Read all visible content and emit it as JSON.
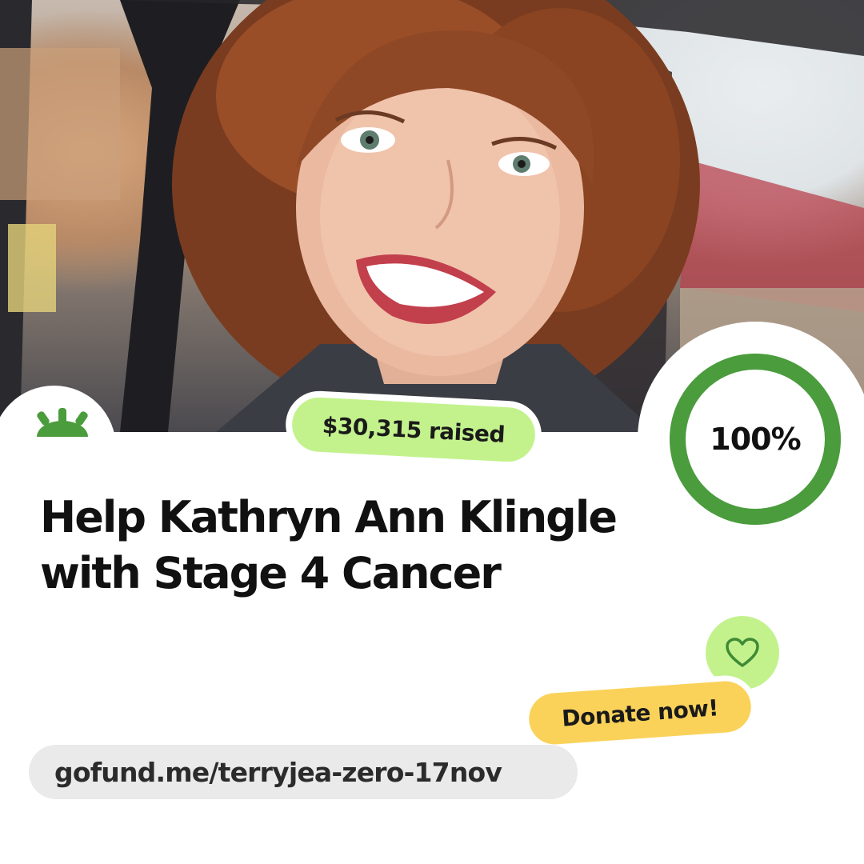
{
  "brand": {
    "logo_icon": "gofundme-sunrise-logo-icon",
    "accent_color": "#4a9c3c",
    "light_green": "#c3f28d",
    "yellow": "#fad25a"
  },
  "photo": {
    "icon": "campaign-photo"
  },
  "campaign": {
    "raised_label": "$30,315 raised",
    "progress_label": "100%",
    "progress_fraction": 1.0,
    "title_line1": "Help Kathryn Ann Klingle",
    "title_line2": "with Stage 4 Cancer"
  },
  "cta": {
    "heart_icon": "heart-icon",
    "donate_label": "Donate now!"
  },
  "link": {
    "url": "gofund.me/terryjea-zero-17nov"
  }
}
